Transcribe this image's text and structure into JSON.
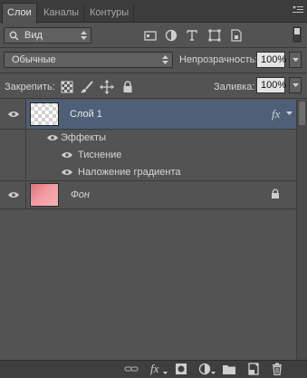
{
  "tabs": [
    {
      "label": "Слои"
    },
    {
      "label": "Каналы"
    },
    {
      "label": "Контуры"
    }
  ],
  "filter": {
    "kind_label": "Вид"
  },
  "blend": {
    "mode": "Обычные",
    "opacity_label": "Непрозрачность:",
    "opacity_value": "100%"
  },
  "lock": {
    "label": "Закрепить:",
    "fill_label": "Заливка:",
    "fill_value": "100%"
  },
  "layers": [
    {
      "name": "Слой 1",
      "fx_label": "fx"
    },
    {
      "name": "Фон"
    }
  ],
  "effects": {
    "header": "Эффекты",
    "items": [
      "Тиснение",
      "Наложение градиента"
    ]
  },
  "bottom_fx_label": "fx",
  "colors": {
    "selected_row": "#4e5f77",
    "panel": "#535353"
  }
}
